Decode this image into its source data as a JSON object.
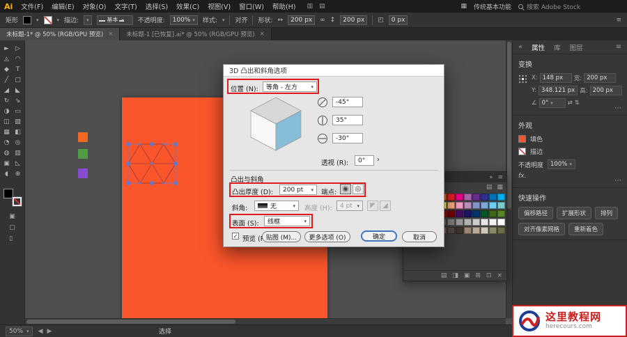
{
  "app": {
    "logo": "Ai"
  },
  "icons": {
    "caret": "▾",
    "chevron": "›",
    "close": "×",
    "menu": "≡",
    "collapse_left": "«",
    "collapse_right": "»",
    "width_arrow": "↔",
    "height_arrow": "↕",
    "link": "∞",
    "more": "⋯",
    "flip_h": "⇄",
    "flip_v": "⇅",
    "cap_butt": "◉",
    "cap_round": "◎",
    "prev": "◀",
    "next": "▶",
    "check": "✓",
    "angle": "∠",
    "corner": "◰",
    "bevel_out": "◤",
    "bevel_in": "◢",
    "arrange": "▥",
    "share": "▤",
    "list": "▤",
    "grid": "▦"
  },
  "menubar": {
    "items": [
      "文件(F)",
      "编辑(E)",
      "对象(O)",
      "文字(T)",
      "选择(S)",
      "效果(C)",
      "视图(V)",
      "窗口(W)",
      "帮助(H)"
    ],
    "workspace": "传统基本功能",
    "search_label": "搜索 Adobe Stock"
  },
  "controlbar": {
    "context": "矩形",
    "stroke_label": "描边:",
    "brush_value": "基本",
    "opacity_label": "不透明度:",
    "opacity_value": "100%",
    "style_label": "样式:",
    "align_label": "对齐",
    "shape_label": "形状:",
    "width_value": "200 px",
    "height_value": "200 px",
    "corner_value": "0 px"
  },
  "tabbar": {
    "tabs": [
      {
        "label": "未标题-1* @ 50% (RGB/GPU 预览)",
        "active": true
      },
      {
        "label": "未标题-1 [已恢复].ai* @ 50% (RGB/GPU 预览)",
        "active": false
      }
    ]
  },
  "toolbar": {
    "tools": [
      {
        "name": "selection-tool",
        "glyph": "►"
      },
      {
        "name": "direct-selection-tool",
        "glyph": "▷"
      },
      {
        "name": "magic-wand-tool",
        "glyph": "◬"
      },
      {
        "name": "lasso-tool",
        "glyph": "◠"
      },
      {
        "name": "pen-tool",
        "glyph": "◆"
      },
      {
        "name": "type-tool",
        "glyph": "T"
      },
      {
        "name": "line-segment-tool",
        "glyph": "╱"
      },
      {
        "name": "rectangle-tool",
        "glyph": "□"
      },
      {
        "name": "paintbrush-tool",
        "glyph": "◢"
      },
      {
        "name": "pencil-tool",
        "glyph": "◣"
      },
      {
        "name": "rotate-tool",
        "glyph": "↻"
      },
      {
        "name": "scale-tool",
        "glyph": "⇘"
      },
      {
        "name": "width-tool",
        "glyph": "◑"
      },
      {
        "name": "free-transform-tool",
        "glyph": "▭"
      },
      {
        "name": "shape-builder-tool",
        "glyph": "◫"
      },
      {
        "name": "perspective-grid-tool",
        "glyph": "▨"
      },
      {
        "name": "mesh-tool",
        "glyph": "▦"
      },
      {
        "name": "gradient-tool",
        "glyph": "◧"
      },
      {
        "name": "eyedropper-tool",
        "glyph": "◔"
      },
      {
        "name": "blend-tool",
        "glyph": "◎"
      },
      {
        "name": "symbol-sprayer-tool",
        "glyph": "◍"
      },
      {
        "name": "column-graph-tool",
        "glyph": "▥"
      },
      {
        "name": "artboard-tool",
        "glyph": "▣"
      },
      {
        "name": "slice-tool",
        "glyph": "◺"
      },
      {
        "name": "hand-tool",
        "glyph": "◖"
      },
      {
        "name": "zoom-tool",
        "glyph": "⊕"
      }
    ],
    "draw_modes": [
      "▣",
      "▢",
      "▯"
    ]
  },
  "canvas": {
    "artboard_color": "#fb552b",
    "swatch_squares": [
      "#f26a22",
      "#4f9e45",
      "#8a4bd1"
    ],
    "wireframe_color": "#9a4040",
    "selection_color": "#4f80e0"
  },
  "dialog": {
    "title": "3D 凸出和斜角选项",
    "position_label": "位置 (N):",
    "position_value": "等角 - 左方",
    "rotate_x_value": "-45°",
    "rotate_y_value": "35°",
    "rotate_z_value": "-30°",
    "perspective_label": "透视 (R):",
    "perspective_value": "0°",
    "section_label": "凸出与斜角",
    "extrude_label": "凸出厚度 (D):",
    "extrude_value": "200 pt",
    "cap_label": "端点:",
    "bevel_label": "斜角:",
    "bevel_value": "无",
    "bevel_height_label": "高度 (H):",
    "bevel_height_value": "4 pt",
    "surface_label": "表面 (S):",
    "surface_value": "线框",
    "preview_label": "预览 (P)",
    "map_button": "贴图 (M)...",
    "more_button": "更多选项 (O)",
    "ok_button": "确定",
    "cancel_button": "取消",
    "cube_colors": {
      "top": "#d8d8d8",
      "left": "#f7f7f7",
      "right": "#86bdd8"
    }
  },
  "annotations": {
    "color": "#e01b1b"
  },
  "floating_panel": {
    "swatch_rows": [
      [
        "#ffffff",
        "#fff200",
        "#ffc20e",
        "#f7941d",
        "#f26522",
        "#ed1c24",
        "#ec008c",
        "#a864a8",
        "#662d91",
        "#2e3192",
        "#0072bc",
        "#00aeef"
      ],
      [
        "#00a651",
        "#39b54a",
        "#8dc63f",
        "#d7df23",
        "#fff568",
        "#f9ad81",
        "#f49ac1",
        "#bd8cbf",
        "#8393ca",
        "#7da7d9",
        "#6dcff6",
        "#7accc8"
      ],
      [
        "#7b2e00",
        "#a0410d",
        "#c66b1e",
        "#e0a024",
        "#9e0b0f",
        "#790000",
        "#440e62",
        "#1b1464",
        "#003471",
        "#005826",
        "#406618",
        "#588528"
      ],
      [
        "#000000",
        "#1a1a1a",
        "#333333",
        "#4d4d4d",
        "#666666",
        "#808080",
        "#999999",
        "#b3b3b3",
        "#cccccc",
        "#e6e6e6",
        "#f2f2f2",
        "#ffffff"
      ],
      [
        "#8c6239",
        "#a67c52",
        "#c69c6d",
        "#e0c9a6",
        "#736357",
        "#534741",
        "#3c352e",
        "#998675",
        "#b7a897",
        "#d1c7b7",
        "#8a8a6a",
        "#6b6b4a"
      ]
    ],
    "footer_icons": [
      {
        "name": "swatch-libraries-icon",
        "glyph": "▤"
      },
      {
        "name": "swatch-kinds-icon",
        "glyph": "◨"
      },
      {
        "name": "swatch-options-icon",
        "glyph": "▣"
      },
      {
        "name": "new-color-group-icon",
        "glyph": "⊞"
      },
      {
        "name": "new-swatch-icon",
        "glyph": "⊡"
      },
      {
        "name": "delete-swatch-icon",
        "glyph": "×"
      }
    ]
  },
  "properties": {
    "tabs": [
      {
        "label": "属性",
        "active": true
      },
      {
        "label": "库",
        "active": false
      },
      {
        "label": "图层",
        "active": false
      }
    ],
    "transform": {
      "title": "变换",
      "x_label": "X:",
      "x_value": "148 px",
      "y_label": "Y:",
      "y_value": "348.121 px",
      "w_label": "宽:",
      "w_value": "200 px",
      "h_label": "高:",
      "h_value": "200 px",
      "angle_value": "0°"
    },
    "appearance": {
      "title": "外观",
      "fill_label": "填色",
      "fill_color": "#fb552b",
      "stroke_label": "描边",
      "opacity_label": "不透明度",
      "opacity_value": "100%",
      "fx_label": "fx."
    },
    "quick_actions": {
      "title": "快速操作",
      "buttons": [
        "偏移路径",
        "扩展形状",
        "排列",
        "对齐像素网格",
        "重新着色"
      ]
    }
  },
  "statusbar": {
    "zoom": "50%",
    "tool": "选择"
  },
  "watermark": {
    "title": "这里教程网",
    "url": "herecours.com"
  }
}
